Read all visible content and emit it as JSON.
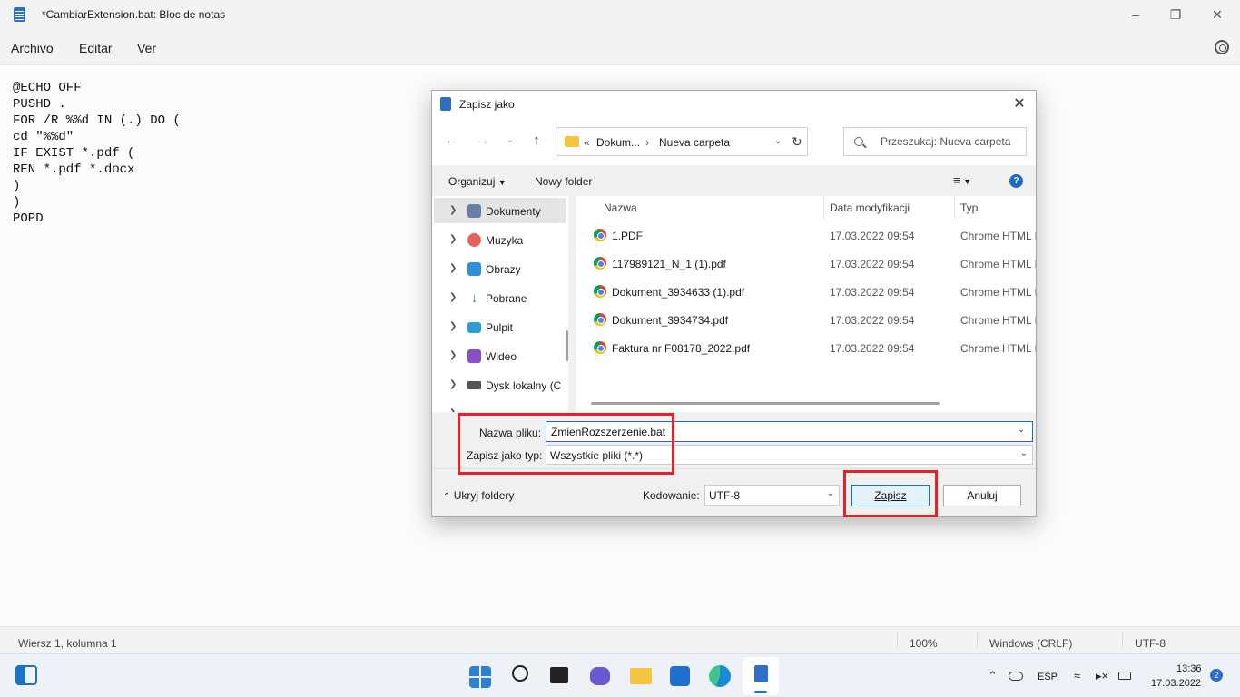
{
  "notepad": {
    "title": "*CambiarExtension.bat: Bloc de notas",
    "menu": [
      "Archivo",
      "Editar",
      "Ver"
    ],
    "code_lines": [
      "@ECHO OFF",
      "PUSHD .",
      "FOR /R %%d IN (.) DO (",
      "cd \"%%d\"",
      "IF EXIST *.pdf (",
      "REN *.pdf *.docx",
      ")",
      ")",
      "POPD"
    ],
    "status": {
      "position": "Wiersz 1, kolumna 1",
      "zoom": "100%",
      "line_ending": "Windows (CRLF)",
      "encoding": "UTF-8"
    }
  },
  "dialog": {
    "title": "Zapisz jako",
    "address": {
      "prefix": "«",
      "parent": "Dokum...",
      "separator": "›",
      "current": "Nueva carpeta"
    },
    "search_placeholder": "Przeszukaj: Nueva carpeta",
    "commands": {
      "organize": "Organizuj",
      "new_folder": "Nowy folder"
    },
    "nav_items": [
      {
        "label": "Dokumenty",
        "icon": "documents-icon",
        "color": "#6b7fa6"
      },
      {
        "label": "Muzyka",
        "icon": "music-icon",
        "color": "#e8605a"
      },
      {
        "label": "Obrazy",
        "icon": "pictures-icon",
        "color": "#2f8fd8"
      },
      {
        "label": "Pobrane",
        "icon": "download-icon",
        "color": "#1f9a68"
      },
      {
        "label": "Pulpit",
        "icon": "desktop-icon",
        "color": "#2a9fd6"
      },
      {
        "label": "Wideo",
        "icon": "video-icon",
        "color": "#8a4fc4"
      },
      {
        "label": "Dysk lokalny (C",
        "icon": "drive-icon",
        "color": "#555555"
      }
    ],
    "columns": {
      "name": "Nazwa",
      "modified": "Data modyfikacji",
      "type": "Typ"
    },
    "files": [
      {
        "name": "1.PDF",
        "modified": "17.03.2022 09:54",
        "type": "Chrome HTML D"
      },
      {
        "name": "117989121_N_1 (1).pdf",
        "modified": "17.03.2022 09:54",
        "type": "Chrome HTML D"
      },
      {
        "name": "Dokument_3934633 (1).pdf",
        "modified": "17.03.2022 09:54",
        "type": "Chrome HTML D"
      },
      {
        "name": "Dokument_3934734.pdf",
        "modified": "17.03.2022 09:54",
        "type": "Chrome HTML D"
      },
      {
        "name": "Faktura nr F08178_2022.pdf",
        "modified": "17.03.2022 09:54",
        "type": "Chrome HTML D"
      }
    ],
    "filename_label": "Nazwa pliku:",
    "filename_value": "ZmienRozszerzenie.bat",
    "filetype_label": "Zapisz jako typ:",
    "filetype_value": "Wszystkie pliki  (*.*)",
    "hide_folders": "Ukryj foldery",
    "encoding_label": "Kodowanie:",
    "encoding_value": "UTF-8",
    "save_button": "Zapisz",
    "cancel_button": "Anuluj"
  },
  "taskbar": {
    "language": "ESP",
    "time": "13:36",
    "date": "17.03.2022",
    "notifications": "2"
  },
  "colors": {
    "highlight": "#e3202b",
    "accent": "#0078d7"
  }
}
